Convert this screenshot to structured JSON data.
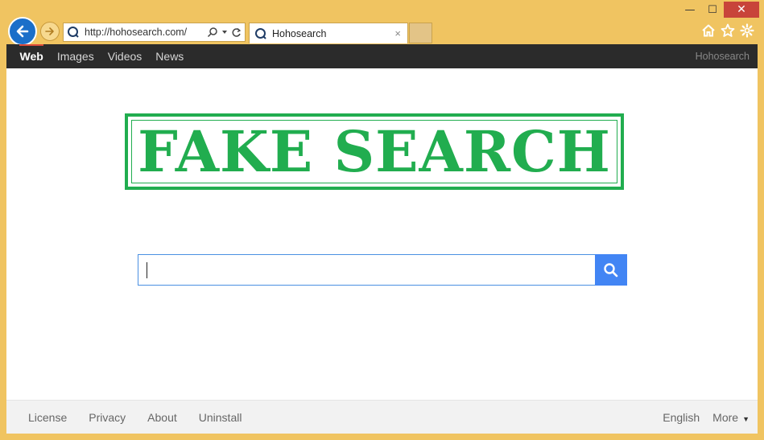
{
  "window": {
    "controls": {
      "minimize": "—",
      "maximize": "☐",
      "close": "✕"
    }
  },
  "address_bar": {
    "url": "http://hohosearch.com/"
  },
  "tab": {
    "title": "Hohosearch",
    "close": "×"
  },
  "top_nav": {
    "items": [
      {
        "label": "Web",
        "active": true
      },
      {
        "label": "Images",
        "active": false
      },
      {
        "label": "Videos",
        "active": false
      },
      {
        "label": "News",
        "active": false
      }
    ],
    "brand": "Hohosearch"
  },
  "stamp": {
    "text": "FAKE SEARCH",
    "color": "#21ad4f"
  },
  "search": {
    "value": "",
    "button_icon": "search-icon",
    "button_color": "#4285f4"
  },
  "footer": {
    "left_links": [
      "License",
      "Privacy",
      "About",
      "Uninstall"
    ],
    "language": "English",
    "more": "More"
  },
  "colors": {
    "window_frame": "#f0c461",
    "nav_bar": "#2b2b2b",
    "close_button": "#c8443a"
  }
}
